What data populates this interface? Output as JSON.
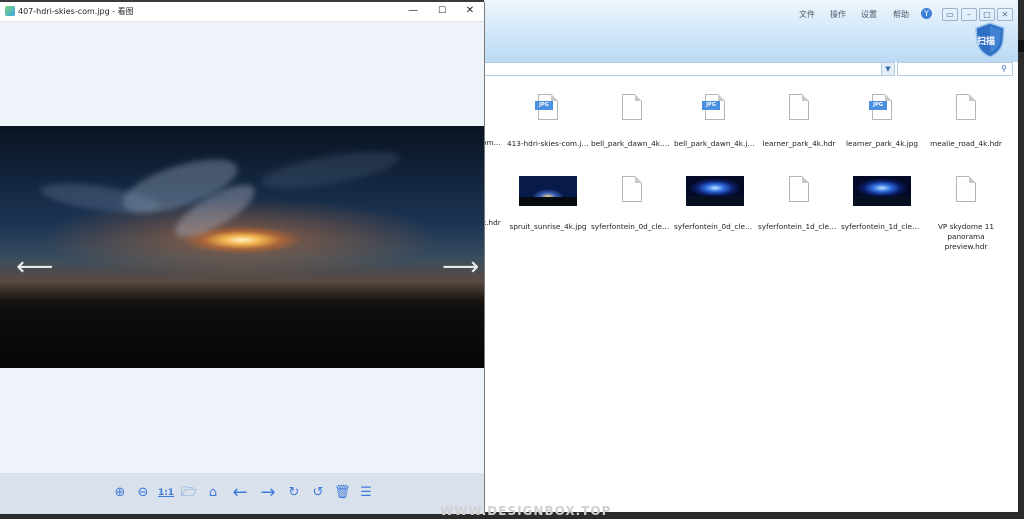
{
  "explorer": {
    "menu": [
      "文件",
      "操作",
      "设置",
      "帮助"
    ],
    "badge_label": "扫描",
    "address_value": "",
    "search_value": "",
    "row1": [
      {
        "name": "om...",
        "type": "partial"
      },
      {
        "name": "413-hdri-skies-com.jpg",
        "type": "jpg"
      },
      {
        "name": "bell_park_dawn_4k.hdr",
        "type": "doc"
      },
      {
        "name": "bell_park_dawn_4k.jpg",
        "type": "jpg"
      },
      {
        "name": "learner_park_4k.hdr",
        "type": "doc"
      },
      {
        "name": "learner_park_4k.jpg",
        "type": "jpg"
      },
      {
        "name": "mealie_road_4k.hdr",
        "type": "doc"
      }
    ],
    "row2": [
      {
        "name": "k.hdr",
        "type": "partial"
      },
      {
        "name": "spruit_sunrise_4k.jpg",
        "type": "thumb"
      },
      {
        "name": "syferfontein_0d_clear...",
        "type": "doc"
      },
      {
        "name": "syferfontein_0d_clear...",
        "type": "thumb2"
      },
      {
        "name": "syferfontein_1d_clear...",
        "type": "doc"
      },
      {
        "name": "syferfontein_1d_clear...",
        "type": "thumb2"
      },
      {
        "name": "VP skydome 11 panorama preview.hdr",
        "type": "doc"
      }
    ],
    "jpg_tag": "JPG"
  },
  "viewer": {
    "title": "407-hdri-skies-com.jpg - 看图",
    "window_buttons": [
      "—",
      "☐",
      "✕"
    ],
    "prev_glyph": "⟵",
    "next_glyph": "⟶",
    "toolbar": [
      {
        "name": "zoom-in-button",
        "glyph": "⊕"
      },
      {
        "name": "zoom-out-button",
        "glyph": "⊖"
      },
      {
        "name": "actual-size-button",
        "glyph": "1:1"
      },
      {
        "name": "open-folder-button",
        "glyph": "🗁"
      },
      {
        "name": "slideshow-button",
        "glyph": "⌂"
      },
      {
        "name": "previous-image-button",
        "glyph": "←"
      },
      {
        "name": "next-image-button",
        "glyph": "→"
      },
      {
        "name": "rotate-right-button",
        "glyph": "↻"
      },
      {
        "name": "rotate-left-button",
        "glyph": "↺"
      },
      {
        "name": "delete-button",
        "glyph": "🗑"
      },
      {
        "name": "more-button",
        "glyph": "☰"
      }
    ]
  },
  "watermark": "WWW.DESIGNBOX.TOP",
  "colors": {
    "accent": "#3f7ad9",
    "jpg_badge": "#4a8fe0"
  }
}
